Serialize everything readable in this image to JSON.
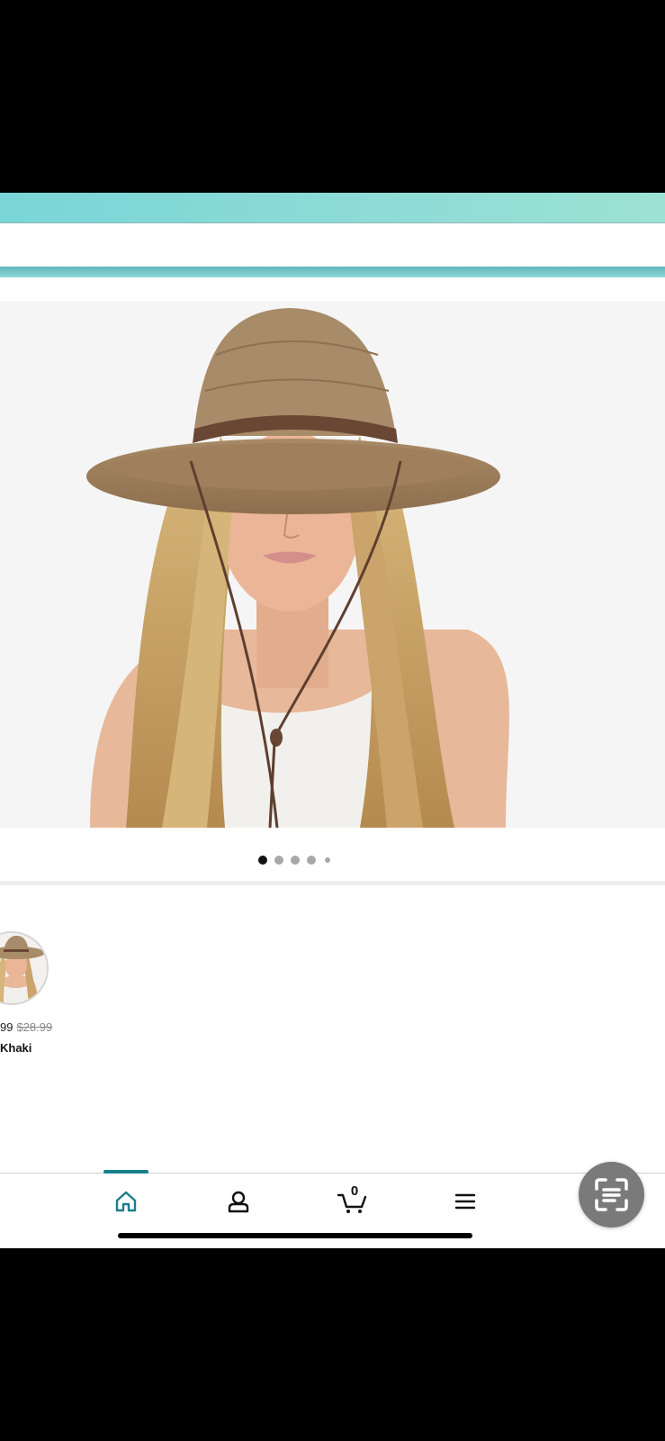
{
  "header": {
    "search_placeholder": ""
  },
  "product": {
    "image_alt": "Woman wearing a wide-brim straw sun hat with brown band and chin strap",
    "carousel": {
      "count": 5,
      "active_index": 0
    }
  },
  "variant": {
    "price_current": "99",
    "price_original": "$28.99",
    "name": "Khaki"
  },
  "bottom_nav": {
    "items": [
      {
        "icon": "home-icon",
        "active": true
      },
      {
        "icon": "account-icon",
        "active": false
      },
      {
        "icon": "cart-icon",
        "active": false
      },
      {
        "icon": "menu-icon",
        "active": false
      }
    ],
    "cart_count": "0"
  },
  "colors": {
    "accent": "#1a7f8c",
    "header_teal": "#8fdcd6",
    "scan_button": "#7a7a7a"
  }
}
